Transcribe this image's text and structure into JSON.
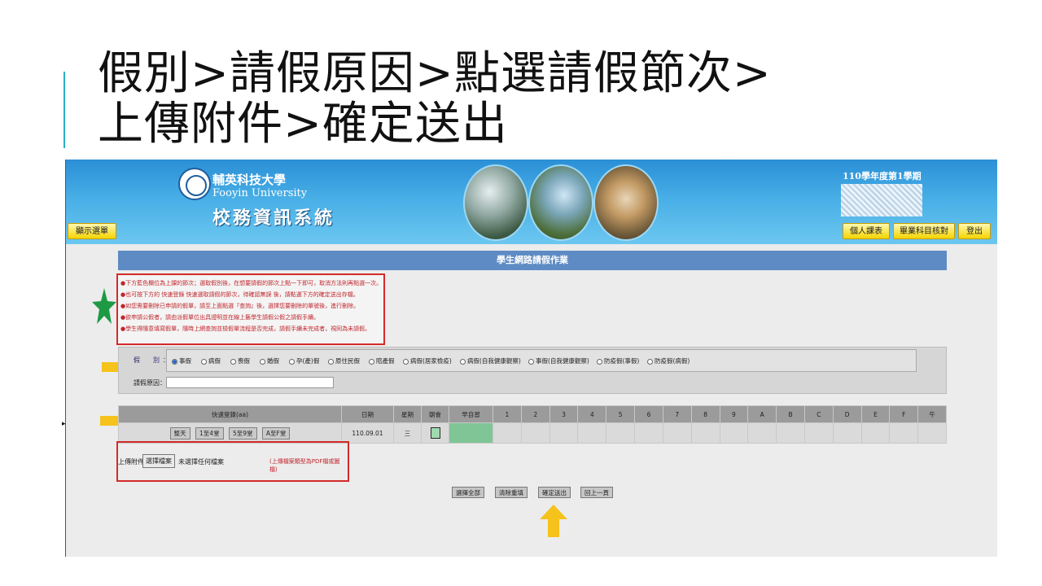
{
  "slide": {
    "title_line1": "假別>請假原因>點選請假節次>",
    "title_line2": "上傳附件>確定送出"
  },
  "banner": {
    "school_cn": "輔英科技大學",
    "school_en": "Fooyin University",
    "system_name": "校務資訊系統",
    "term": "110學年度第1學期",
    "show_menu": "顯示選單",
    "btn_schedule": "個人課表",
    "btn_graduation": "畢業科目核對",
    "btn_logout": "登出"
  },
  "page": {
    "heading": "學生網路請假作業"
  },
  "notes": [
    "●下方藍色欄位為上課的節次；選取假別後，在想要請假的節次上點一下即可，取消方法則再點選一次。",
    "●也可按下方的 快速登錄 快速選取請假的節次，待確認無誤 後，請點選下方的確定送出存檔。",
    "●如您需要刪除已申請的假單，請至上面點選『查詢』後，選擇您要刪除的單號後，進行刪除。",
    "●欲申請公假者，請由派假單位出具證明並在線上藝學生請假公假之請假手續。",
    "●學生得隨意填寫假單，隨時上網查詢並檢假單流程是否完成，請假手續未完成者，視同為未請假。"
  ],
  "form": {
    "leave_type_label": "假　別：",
    "leave_types": [
      {
        "label": "事假",
        "selected": true
      },
      {
        "label": "病假",
        "selected": false
      },
      {
        "label": "喪假",
        "selected": false
      },
      {
        "label": "婚假",
        "selected": false
      },
      {
        "label": "孕(產)假",
        "selected": false
      },
      {
        "label": "原住民假",
        "selected": false
      },
      {
        "label": "陪產假",
        "selected": false
      },
      {
        "label": "病假(居家檢疫)",
        "selected": false
      },
      {
        "label": "病假(自我健康觀察)",
        "selected": false
      },
      {
        "label": "事假(自我健康觀察)",
        "selected": false
      },
      {
        "label": "防疫假(事假)",
        "selected": false
      },
      {
        "label": "防疫假(病假)",
        "selected": false
      }
    ],
    "reason_label": "請假原因：",
    "reason_value": ""
  },
  "table": {
    "headers": [
      "快速登錄(aa)",
      "日期",
      "星期",
      "朝會",
      "早自習",
      "1",
      "2",
      "3",
      "4",
      "5",
      "6",
      "7",
      "8",
      "9",
      "A",
      "B",
      "C",
      "D",
      "E",
      "F",
      "午"
    ],
    "quick_buttons": [
      "整天",
      "1至4堂",
      "5至9堂",
      "A至F堂"
    ],
    "row": {
      "date": "110.09.01",
      "weekday": "三"
    }
  },
  "upload": {
    "label": "上傳附件",
    "choose": "選擇檔案",
    "no_file": "未選擇任何檔案",
    "hint": "(上傳檔案類型為PDF檔或圖檔)"
  },
  "actions": {
    "select_all": "選擇全部",
    "clear": "清除重填",
    "submit": "確定送出",
    "back": "回上一頁"
  },
  "colors": {
    "banner_blue": "#3aa1e0",
    "heading_blue": "#5e8bc4",
    "red_outline": "#d42a2a",
    "yellow_arrow": "#f6c21c",
    "green_star": "#1e9a44",
    "selected_cell": "#7fc596"
  }
}
